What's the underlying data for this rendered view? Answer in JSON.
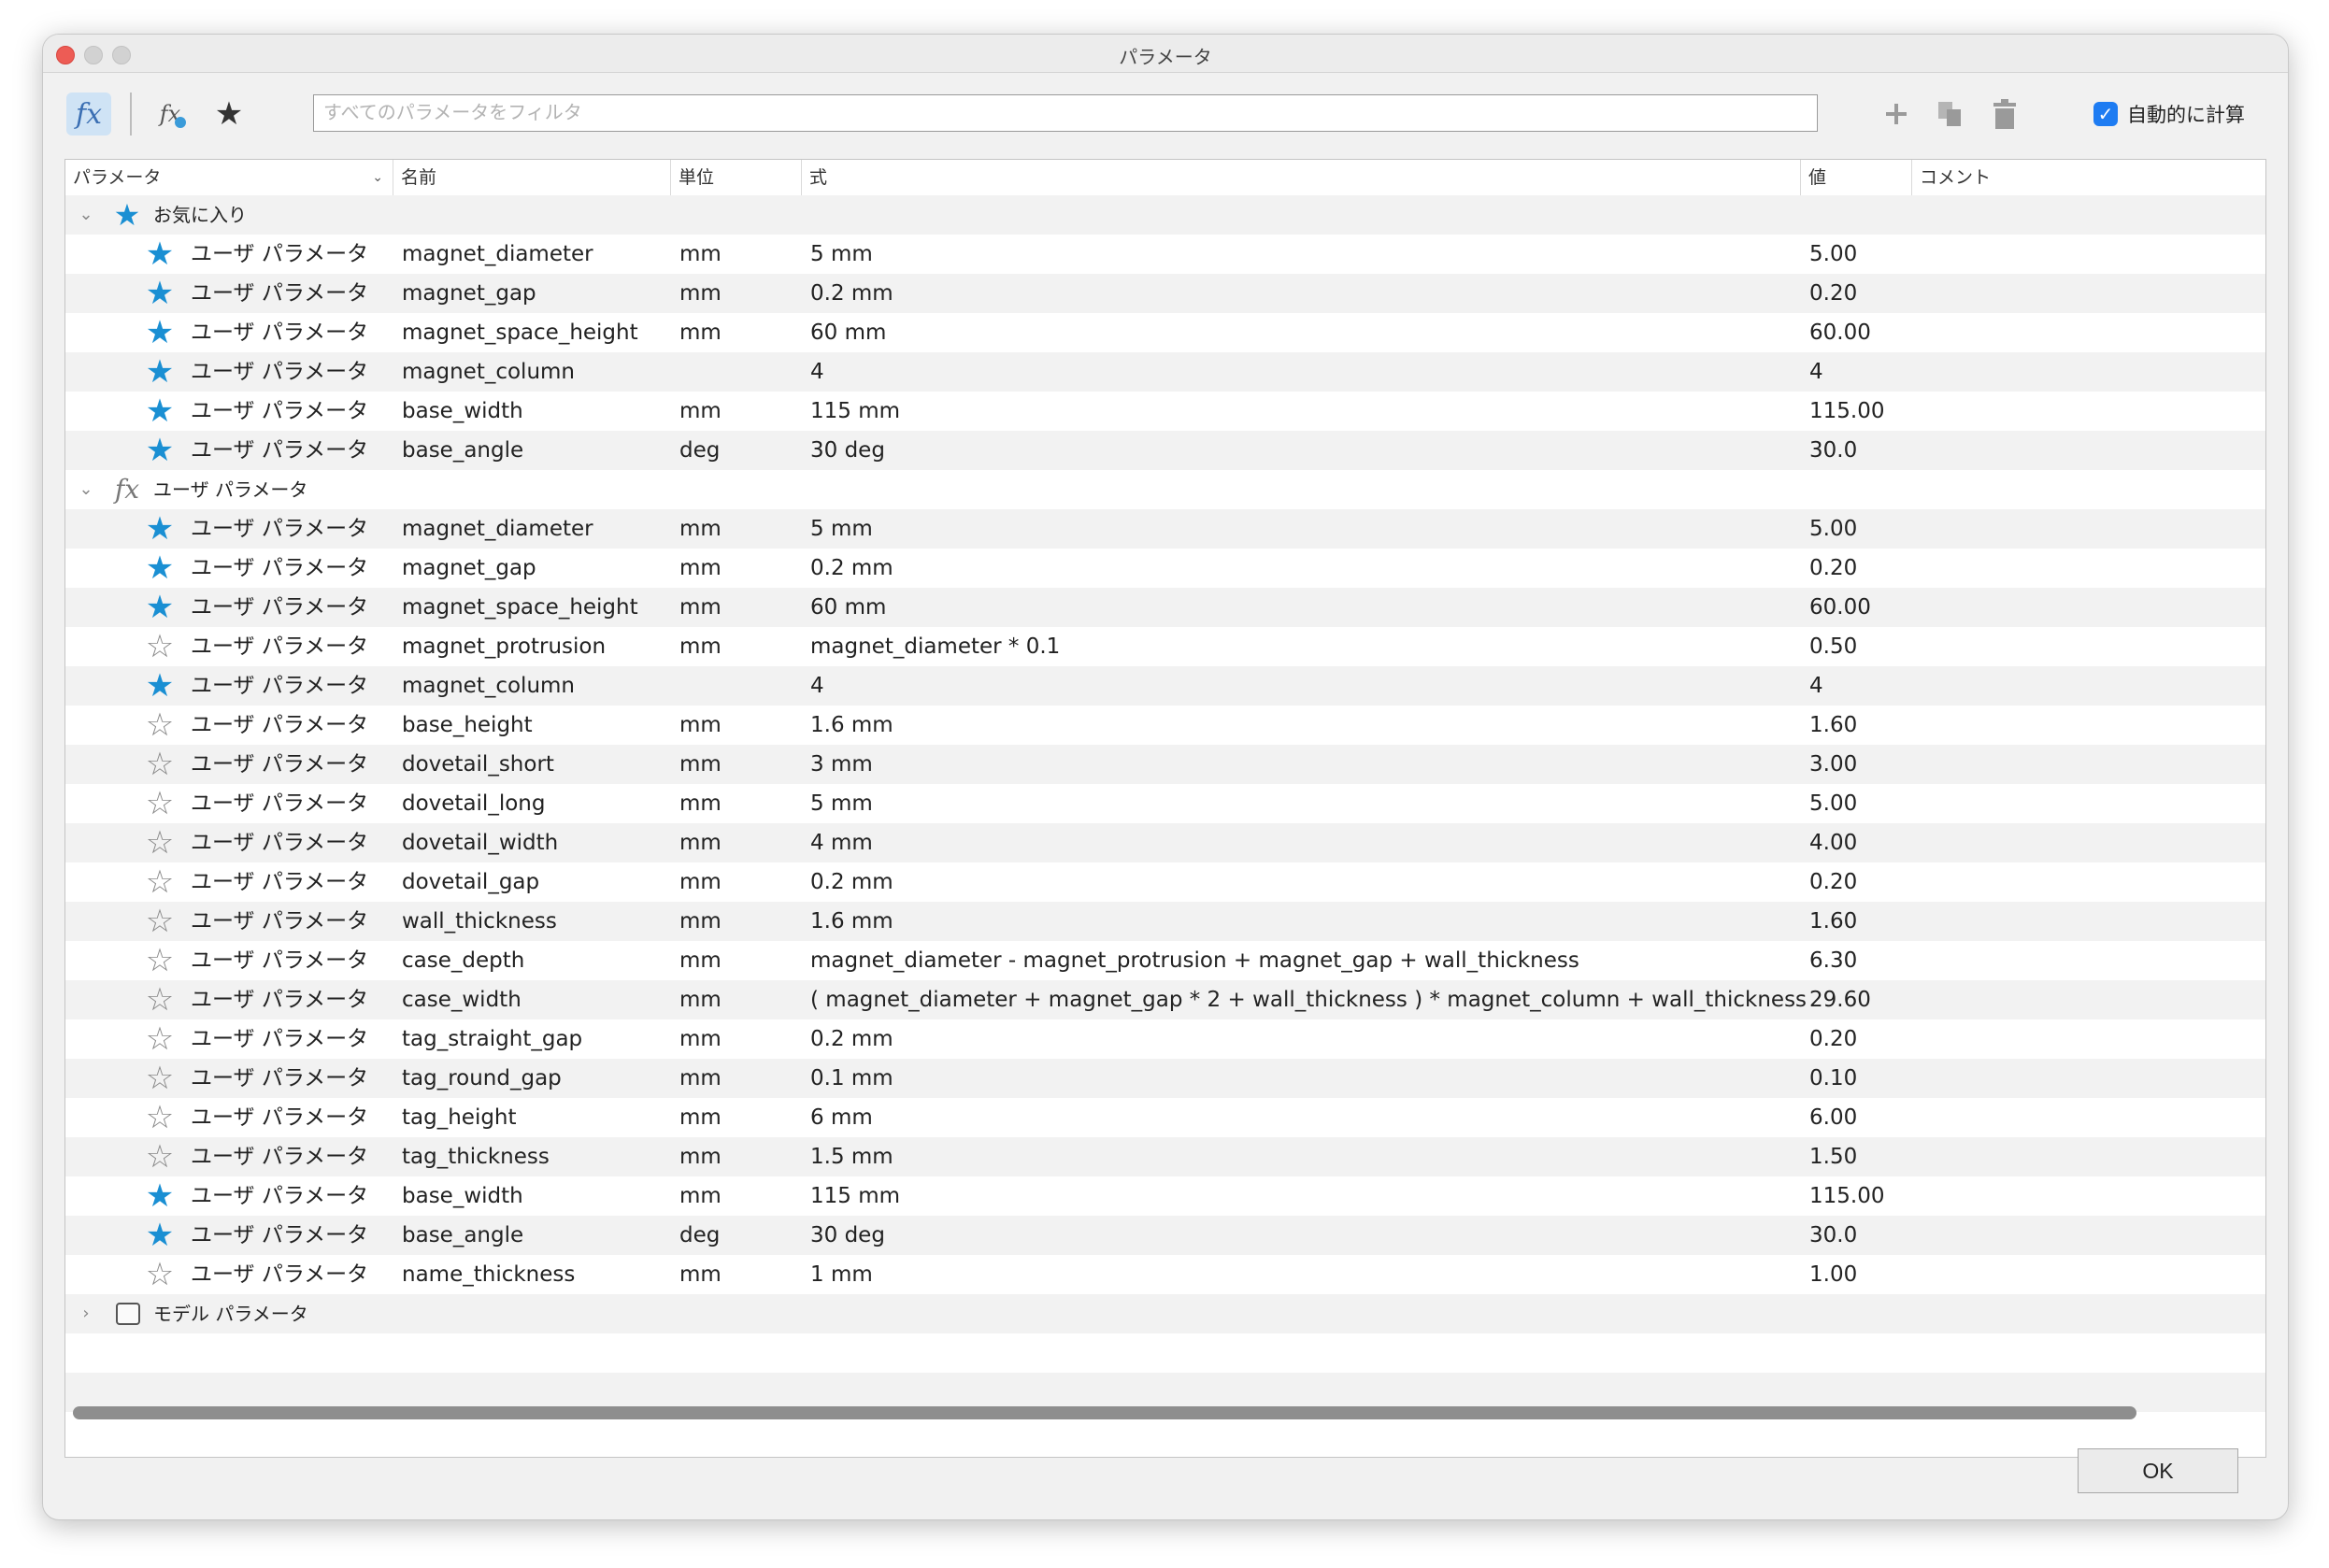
{
  "window": {
    "title": "パラメータ"
  },
  "toolbar": {
    "fx_icon": "fx-icon",
    "user_fx_icon": "user-fx-icon",
    "favorite_icon": "star-icon",
    "filter_placeholder": "すべてのパラメータをフィルタ",
    "add_icon": "plus-icon",
    "copy_icon": "copy-icon",
    "delete_icon": "trash-icon",
    "auto_calc_label": "自動的に計算",
    "auto_calc_checked": true
  },
  "table": {
    "headers": [
      "パラメータ",
      "名前",
      "単位",
      "式",
      "値",
      "コメント"
    ],
    "favorites_group": {
      "label": "お気に入り",
      "expanded": true,
      "rows": [
        {
          "fav": true,
          "type": "ユーザ パラメータ",
          "name": "magnet_diameter",
          "unit": "mm",
          "expr": "5 mm",
          "value": "5.00"
        },
        {
          "fav": true,
          "type": "ユーザ パラメータ",
          "name": "magnet_gap",
          "unit": "mm",
          "expr": "0.2 mm",
          "value": "0.20"
        },
        {
          "fav": true,
          "type": "ユーザ パラメータ",
          "name": "magnet_space_height",
          "unit": "mm",
          "expr": "60 mm",
          "value": "60.00"
        },
        {
          "fav": true,
          "type": "ユーザ パラメータ",
          "name": "magnet_column",
          "unit": "",
          "expr": "4",
          "value": "4"
        },
        {
          "fav": true,
          "type": "ユーザ パラメータ",
          "name": "base_width",
          "unit": "mm",
          "expr": "115 mm",
          "value": "115.00"
        },
        {
          "fav": true,
          "type": "ユーザ パラメータ",
          "name": "base_angle",
          "unit": "deg",
          "expr": "30 deg",
          "value": "30.0"
        }
      ]
    },
    "user_group": {
      "label": "ユーザ パラメータ",
      "expanded": true,
      "rows": [
        {
          "fav": true,
          "type": "ユーザ パラメータ",
          "name": "magnet_diameter",
          "unit": "mm",
          "expr": "5 mm",
          "value": "5.00"
        },
        {
          "fav": true,
          "type": "ユーザ パラメータ",
          "name": "magnet_gap",
          "unit": "mm",
          "expr": "0.2 mm",
          "value": "0.20"
        },
        {
          "fav": true,
          "type": "ユーザ パラメータ",
          "name": "magnet_space_height",
          "unit": "mm",
          "expr": "60 mm",
          "value": "60.00"
        },
        {
          "fav": false,
          "type": "ユーザ パラメータ",
          "name": "magnet_protrusion",
          "unit": "mm",
          "expr": "magnet_diameter * 0.1",
          "value": "0.50"
        },
        {
          "fav": true,
          "type": "ユーザ パラメータ",
          "name": "magnet_column",
          "unit": "",
          "expr": "4",
          "value": "4"
        },
        {
          "fav": false,
          "type": "ユーザ パラメータ",
          "name": "base_height",
          "unit": "mm",
          "expr": "1.6 mm",
          "value": "1.60"
        },
        {
          "fav": false,
          "type": "ユーザ パラメータ",
          "name": "dovetail_short",
          "unit": "mm",
          "expr": "3 mm",
          "value": "3.00"
        },
        {
          "fav": false,
          "type": "ユーザ パラメータ",
          "name": "dovetail_long",
          "unit": "mm",
          "expr": "5 mm",
          "value": "5.00"
        },
        {
          "fav": false,
          "type": "ユーザ パラメータ",
          "name": "dovetail_width",
          "unit": "mm",
          "expr": "4 mm",
          "value": "4.00"
        },
        {
          "fav": false,
          "type": "ユーザ パラメータ",
          "name": "dovetail_gap",
          "unit": "mm",
          "expr": "0.2 mm",
          "value": "0.20"
        },
        {
          "fav": false,
          "type": "ユーザ パラメータ",
          "name": "wall_thickness",
          "unit": "mm",
          "expr": "1.6 mm",
          "value": "1.60"
        },
        {
          "fav": false,
          "type": "ユーザ パラメータ",
          "name": "case_depth",
          "unit": "mm",
          "expr": "magnet_diameter - magnet_protrusion + magnet_gap + wall_thickness",
          "value": "6.30"
        },
        {
          "fav": false,
          "type": "ユーザ パラメータ",
          "name": "case_width",
          "unit": "mm",
          "expr": "( magnet_diameter + magnet_gap * 2 + wall_thickness ) * magnet_column + wall_thickness",
          "value": "29.60"
        },
        {
          "fav": false,
          "type": "ユーザ パラメータ",
          "name": "tag_straight_gap",
          "unit": "mm",
          "expr": "0.2 mm",
          "value": "0.20"
        },
        {
          "fav": false,
          "type": "ユーザ パラメータ",
          "name": "tag_round_gap",
          "unit": "mm",
          "expr": "0.1 mm",
          "value": "0.10"
        },
        {
          "fav": false,
          "type": "ユーザ パラメータ",
          "name": "tag_height",
          "unit": "mm",
          "expr": "6 mm",
          "value": "6.00"
        },
        {
          "fav": false,
          "type": "ユーザ パラメータ",
          "name": "tag_thickness",
          "unit": "mm",
          "expr": "1.5 mm",
          "value": "1.50"
        },
        {
          "fav": true,
          "type": "ユーザ パラメータ",
          "name": "base_width",
          "unit": "mm",
          "expr": "115 mm",
          "value": "115.00"
        },
        {
          "fav": true,
          "type": "ユーザ パラメータ",
          "name": "base_angle",
          "unit": "deg",
          "expr": "30 deg",
          "value": "30.0"
        },
        {
          "fav": false,
          "type": "ユーザ パラメータ",
          "name": "name_thickness",
          "unit": "mm",
          "expr": "1 mm",
          "value": "1.00"
        }
      ]
    },
    "model_group": {
      "label": "モデル パラメータ",
      "expanded": false
    }
  },
  "footer": {
    "ok_label": "OK"
  },
  "colors": {
    "accent": "#1e7cf2",
    "star_on": "#1a8fd3",
    "star_off": "#8a8a8a",
    "alt_row": "#f2f2f2"
  }
}
